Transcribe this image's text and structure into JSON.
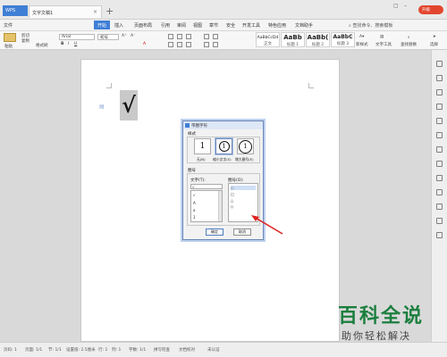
{
  "titlebar": {
    "app_tab": "WPS",
    "doc_tab": "文字文稿1",
    "upgrade_badge": "升级"
  },
  "menubar": {
    "file": "文件",
    "items": [
      "开始",
      "插入",
      "页面布局",
      "引用",
      "审阅",
      "视图",
      "章节",
      "安全",
      "开发工具",
      "特色应用",
      "文档助手"
    ],
    "active": "开始",
    "search": "查找命令、搜索模板"
  },
  "ribbon": {
    "paste": "粘贴",
    "cut": "剪切",
    "copy": "复制",
    "format_painter": "格式刷",
    "font": "Arial",
    "size": "初号",
    "styles": [
      {
        "sample": "AaBbCcDd",
        "name": "正文"
      },
      {
        "sample": "AaBb",
        "name": "标题 1"
      },
      {
        "sample": "AaBb(",
        "name": "标题 2"
      },
      {
        "sample": "AaBbC",
        "name": "标题 3"
      }
    ],
    "new_style": "新样式",
    "text_tool": "文字工具",
    "find_replace": "查找替换",
    "select": "选择"
  },
  "document": {
    "content": "√"
  },
  "dialog": {
    "title": "带圈字符",
    "style_group": "样式",
    "options": [
      {
        "label": "无(N)",
        "glyph": "1"
      },
      {
        "label": "缩小文字(S)",
        "glyph": "1"
      },
      {
        "label": "增大圈号(E)",
        "glyph": "1"
      }
    ],
    "circle_group": "圈号",
    "text_label": "文字(T):",
    "text_value": "√",
    "text_list": [
      "√",
      "A",
      "a",
      "1"
    ],
    "enclosure_label": "圈号(O):",
    "enclosure_list": [
      "○",
      "□",
      "△",
      "◇"
    ],
    "ok": "确定",
    "cancel": "取消"
  },
  "statusbar": {
    "page_num": "页码: 1",
    "page": "页面: 1/1",
    "section": "节: 1/1",
    "position": "设置值: 2.5厘米",
    "row": "行: 1",
    "col": "列: 1",
    "words": "字数: 1/1",
    "spell": "拼写检查",
    "proof": "文档校对",
    "cert": "未认证"
  },
  "watermark": {
    "logo": "百科全说",
    "tagline": "助你轻松解决"
  },
  "colors": {
    "accent": "#3f7fd6",
    "brand_green": "#1c7f3e",
    "arrow": "#e02020"
  }
}
